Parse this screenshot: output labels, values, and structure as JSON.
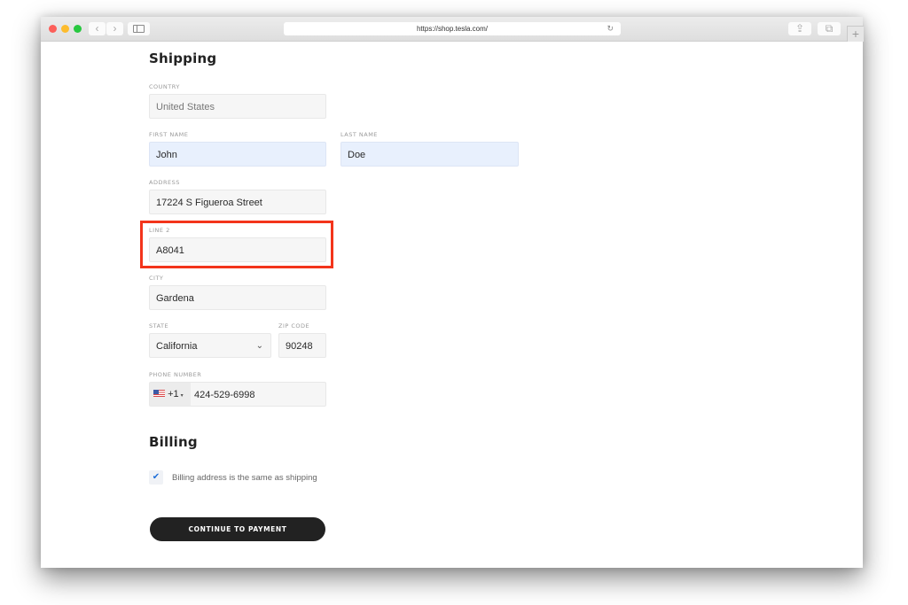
{
  "browser": {
    "url": "https://shop.tesla.com/",
    "back_icon": "‹",
    "forward_icon": "›",
    "reload_icon": "↻",
    "share_icon": "⇪",
    "tabs_icon": "⧉",
    "new_tab_icon": "+"
  },
  "shipping": {
    "title": "Shipping",
    "country": {
      "label": "COUNTRY",
      "value": "United States"
    },
    "first_name": {
      "label": "FIRST NAME",
      "value": "John"
    },
    "last_name": {
      "label": "LAST NAME",
      "value": "Doe"
    },
    "address": {
      "label": "ADDRESS",
      "value": "17224 S Figueroa Street"
    },
    "line2": {
      "label": "LINE 2",
      "value": "A8041"
    },
    "city": {
      "label": "CITY",
      "value": "Gardena"
    },
    "state": {
      "label": "STATE",
      "value": "California",
      "chevron": "⌄"
    },
    "zip": {
      "label": "ZIP CODE",
      "value": "90248"
    },
    "phone": {
      "label": "PHONE NUMBER",
      "country_code": "+1",
      "caret": "▾",
      "value": "424-529-6998"
    }
  },
  "billing": {
    "title": "Billing",
    "same_as_shipping": {
      "checked": true,
      "check_glyph": "✔",
      "label": "Billing address is the same as shipping"
    }
  },
  "cta": {
    "label": "CONTINUE TO PAYMENT"
  },
  "colors": {
    "highlight": "#f3341b",
    "button": "#222222",
    "checkbox_check": "#1e6fd9",
    "autofill": "#e8f0fd"
  }
}
